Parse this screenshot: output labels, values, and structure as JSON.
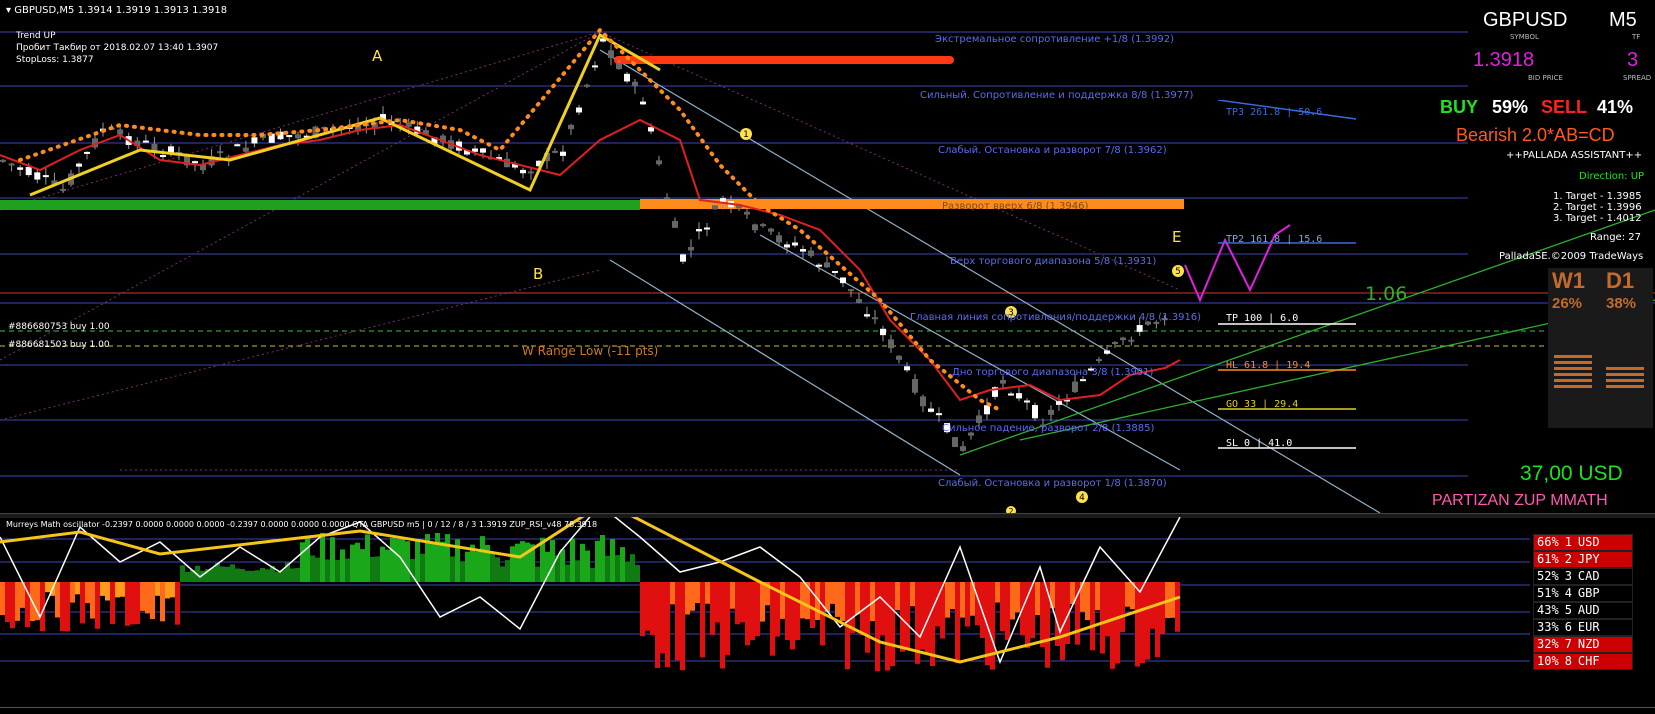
{
  "window": {
    "symbol_header": "GBPUSD,M5",
    "ohlc": "1.3914 1.3919 1.3913 1.3918"
  },
  "info_box": {
    "line1": "Trend UP",
    "line2": "Пробит Такбир от 2018.02.07 13:40 1.3907",
    "line3": "StopLoss: 1.3877"
  },
  "wave_labels": {
    "A": "A",
    "B": "B",
    "E": "E"
  },
  "wave_numbers": [
    "1",
    "2",
    "3",
    "4",
    "5"
  ],
  "murrey_levels": [
    "Экстремальное сопротивление +1/8  (1.3992)",
    "Сильный. Сопротивление и поддержка 8/8  (1.3977)",
    "Слабый. Остановка и разворот 7/8  (1.3962)",
    "Разворот вверх 6/8  (1.3946)",
    "Верх торгового диапазона 5/8  (1.3931)",
    "Главная линия сопротивления/поддержки 4/8  (1.3916)",
    "Дно торгового диапазона 3/8  (1.3901)",
    "Сильное падение, разворот 2/8  (1.3885)",
    "Слабый. Остановка и разворот 1/8  (1.3870)"
  ],
  "orders": [
    "#886680753 buy 1.00",
    "#886681503 buy 1.00"
  ],
  "w_range": "W Range Low (-11 pts)",
  "targets": {
    "tp3": "TP3 261.8  | 50.6",
    "tp2": "TP2 161.8  | 15.6",
    "tp": "TP  100   | 6.0",
    "hl": "HL  61.8  | 19.4",
    "go": "GO  33    | 29.4",
    "sl": "SL  0     | 41.0"
  },
  "fib_note": "1.06",
  "panel": {
    "symbol": "GBPUSD",
    "symbol_caption": "SYMBOL",
    "tf": "M5",
    "tf_caption": "TF",
    "bid": "1.3918",
    "bid_caption": "BID PRICE",
    "spread": "3",
    "spread_caption": "SPREAD",
    "buy_label": "BUY",
    "buy_pct": "59%",
    "sell_label": "SELL",
    "sell_pct": "41%",
    "pattern": "Bearish 2.0*AB=CD",
    "assistant": "++PALLADA ASSISTANT++",
    "direction": "Direction: UP",
    "target1": "1. Target - 1.3985",
    "target2": "2. Target - 1.3996",
    "target3": "3. Target - 1.4012",
    "range": "Range: 27",
    "copyright": "PalladaSE.©2009 TradeWays",
    "w1": "W1",
    "d1": "D1",
    "w1_pct": "26%",
    "d1_pct": "38%",
    "profit": "37,00 USD",
    "brand": "PARTIZAN ZUP MMATH"
  },
  "oscillator": {
    "header": "Murreys Math oscillator -0.2397 0.0000 0.0000 0.0000 -0.2397 0.0000 0.0000 0.0000  QTA GBPUSD m5 | 0 / 12 / 8 / 3 1.3919  ZUP_RSI_v48 78.3918"
  },
  "currency_strength": [
    {
      "pct": "66%",
      "rank": "1",
      "cur": "USD",
      "bg": "#cc0000"
    },
    {
      "pct": "61%",
      "rank": "2",
      "cur": "JPY",
      "bg": "#cc0000"
    },
    {
      "pct": "52%",
      "rank": "3",
      "cur": "CAD",
      "bg": "#000000"
    },
    {
      "pct": "51%",
      "rank": "4",
      "cur": "GBP",
      "bg": "#000000"
    },
    {
      "pct": "43%",
      "rank": "5",
      "cur": "AUD",
      "bg": "#000000"
    },
    {
      "pct": "33%",
      "rank": "6",
      "cur": "EUR",
      "bg": "#000000"
    },
    {
      "pct": "32%",
      "rank": "7",
      "cur": "NZD",
      "bg": "#cc0000"
    },
    {
      "pct": "10%",
      "rank": "8",
      "cur": "CHF",
      "bg": "#cc0000"
    }
  ],
  "colors": {
    "background": "#000000",
    "murrey_line": "#4b5bd9",
    "bullish_bar": "#888888",
    "ema_red": "#e02020",
    "zigzag": "#ffe14a",
    "buy_green": "#20e020",
    "sell_red": "#ff2020",
    "pattern_orange": "#ff5a1e"
  }
}
